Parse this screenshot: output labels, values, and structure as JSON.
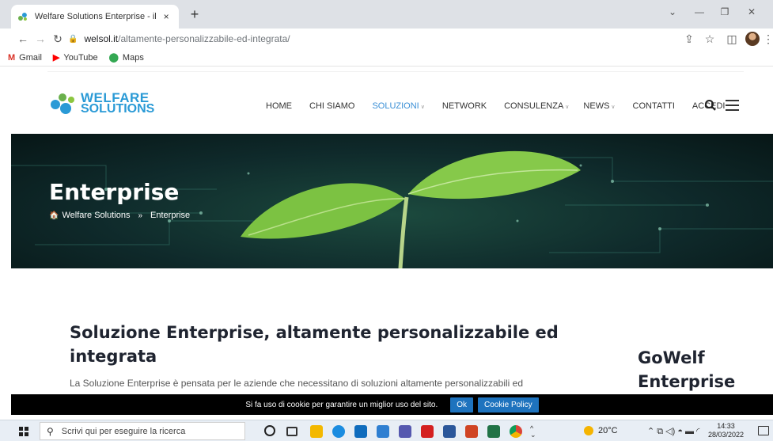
{
  "browser": {
    "tab_title": "Welfare Solutions Enterprise - il",
    "tab_close": "×",
    "new_tab": "+",
    "url_host": "welsol.it",
    "url_path": "/altamente-personalizzabile-ed-integrata/",
    "bookmarks": [
      "Gmail",
      "YouTube",
      "Maps"
    ]
  },
  "site": {
    "nav": [
      "HOME",
      "CHI SIAMO",
      "SOLUZIONI",
      "NETWORK",
      "CONSULENZA",
      "NEWS",
      "CONTATTI",
      "ACCEDI"
    ],
    "logo_line1": "WELFARE",
    "logo_line2": "SOLUTIONS",
    "hero_title": "Enterprise",
    "breadcrumb_home": "Welfare Solutions",
    "breadcrumb_sep": "»",
    "breadcrumb_current": "Enterprise",
    "content_title": "Soluzione Enterprise, altamente personalizzabile ed integrata",
    "content_text": "La Soluzione Enterprise è pensata per le aziende che necessitano di soluzioni altamente personalizzabili ed",
    "side_title": "GoWelf Enterprise",
    "accent_color": "#3a8fd6"
  },
  "cookie": {
    "text": "Si fa uso di cookie per garantire un miglior uso del sito.",
    "ok_label": "Ok",
    "policy_label": "Cookie Policy"
  },
  "taskbar": {
    "search_placeholder": "Scrivi qui per eseguire la ricerca",
    "temperature": "20°C",
    "time": "14:33",
    "date": "28/03/2022"
  }
}
